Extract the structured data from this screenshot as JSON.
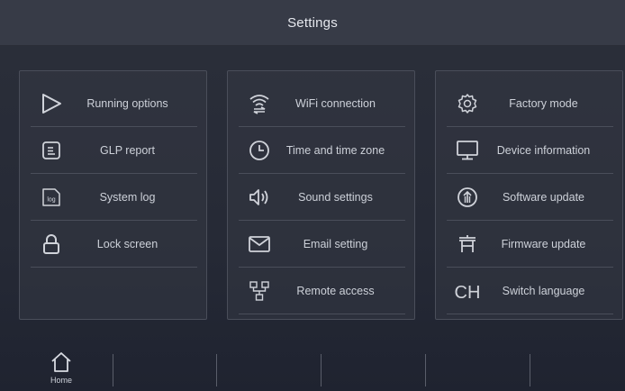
{
  "header": {
    "title": "Settings"
  },
  "panels": {
    "left": [
      {
        "label": "Running options",
        "icon": "play-icon"
      },
      {
        "label": "GLP report",
        "icon": "report-icon"
      },
      {
        "label": "System log",
        "icon": "log-icon",
        "icon_text": "log"
      },
      {
        "label": "Lock screen",
        "icon": "lock-icon"
      }
    ],
    "middle": [
      {
        "label": "WiFi connection",
        "icon": "wifi-icon"
      },
      {
        "label": "Time and time zone",
        "icon": "clock-icon"
      },
      {
        "label": "Sound settings",
        "icon": "speaker-icon"
      },
      {
        "label": "Email setting",
        "icon": "email-icon"
      },
      {
        "label": "Remote access",
        "icon": "network-icon"
      }
    ],
    "right": [
      {
        "label": "Factory mode",
        "icon": "gear-icon"
      },
      {
        "label": "Device information",
        "icon": "monitor-icon"
      },
      {
        "label": "Software update",
        "icon": "update-icon"
      },
      {
        "label": "Firmware update",
        "icon": "firmware-icon"
      },
      {
        "label": "Switch language",
        "icon": "language-icon",
        "icon_text": "CH"
      }
    ]
  },
  "bottombar": {
    "home_label": "Home"
  },
  "colors": {
    "background": "#262a36",
    "titlebar": "#373b47",
    "divider": "#4a4e5a",
    "text": "#cdd1d9"
  }
}
